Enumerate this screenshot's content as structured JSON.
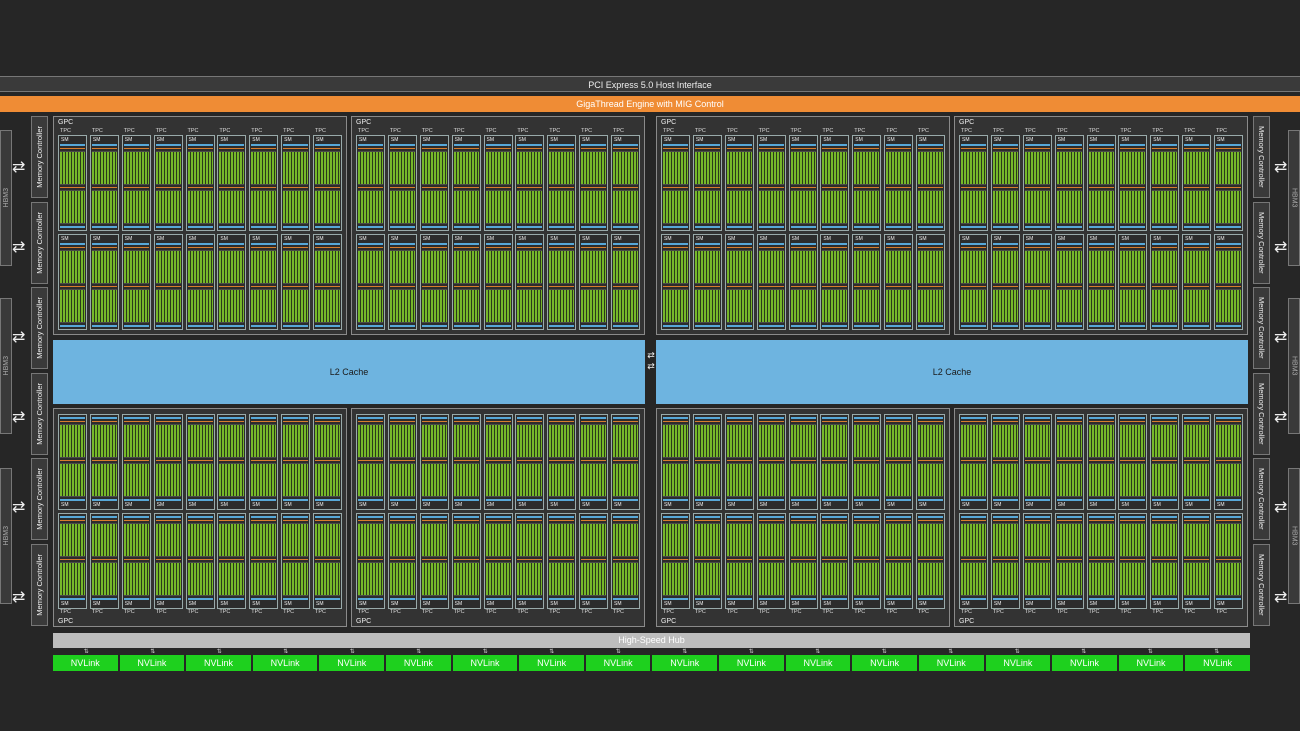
{
  "pcie": {
    "label": "PCI Express 5.0 Host Interface"
  },
  "gigathread": {
    "label": "GigaThread Engine with MIG Control"
  },
  "memory_controller_label": "Memory Controller",
  "hbm_label": "HBM3",
  "gpc_label": "GPC",
  "tpc_label": "TPC",
  "sm_label": "SM",
  "l2_label": "L2 Cache",
  "hub_label": "High-Speed Hub",
  "nvlink_label": "NVLink",
  "nvlink_count": 18,
  "gpcs_per_row": 4,
  "tpcs_per_gpc": 9,
  "colors": {
    "background": "#262626",
    "gigathread": "#ef8c35",
    "l2": "#6eb4e0",
    "nvlink": "#1ed01e",
    "core": "#76b82a",
    "hub": "#bdbdbd"
  }
}
